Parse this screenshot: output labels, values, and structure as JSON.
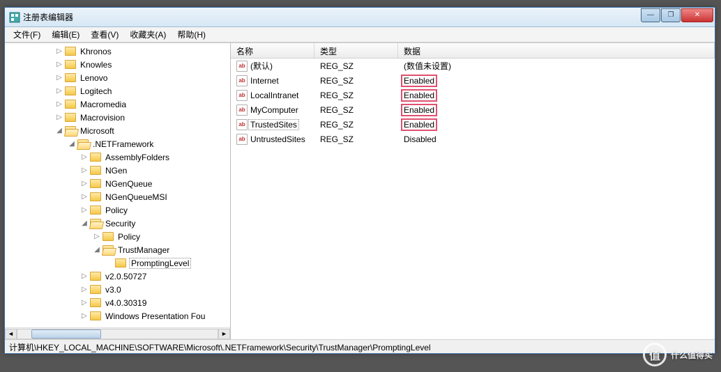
{
  "window": {
    "title": "注册表编辑器"
  },
  "menus": {
    "file": "文件(F)",
    "edit": "编辑(E)",
    "view": "查看(V)",
    "favorites": "收藏夹(A)",
    "help": "帮助(H)"
  },
  "tree": [
    {
      "indent": 4,
      "exp": "▷",
      "open": false,
      "label": "Khronos"
    },
    {
      "indent": 4,
      "exp": "▷",
      "open": false,
      "label": "Knowles"
    },
    {
      "indent": 4,
      "exp": "▷",
      "open": false,
      "label": "Lenovo"
    },
    {
      "indent": 4,
      "exp": "▷",
      "open": false,
      "label": "Logitech"
    },
    {
      "indent": 4,
      "exp": "▷",
      "open": false,
      "label": "Macromedia"
    },
    {
      "indent": 4,
      "exp": "▷",
      "open": false,
      "label": "Macrovision"
    },
    {
      "indent": 4,
      "exp": "◢",
      "open": true,
      "label": "Microsoft"
    },
    {
      "indent": 5,
      "exp": "◢",
      "open": true,
      "label": ".NETFramework"
    },
    {
      "indent": 6,
      "exp": "▷",
      "open": false,
      "label": "AssemblyFolders"
    },
    {
      "indent": 6,
      "exp": "▷",
      "open": false,
      "label": "NGen"
    },
    {
      "indent": 6,
      "exp": "▷",
      "open": false,
      "label": "NGenQueue"
    },
    {
      "indent": 6,
      "exp": "▷",
      "open": false,
      "label": "NGenQueueMSI"
    },
    {
      "indent": 6,
      "exp": "▷",
      "open": false,
      "label": "Policy"
    },
    {
      "indent": 6,
      "exp": "◢",
      "open": true,
      "label": "Security"
    },
    {
      "indent": 7,
      "exp": "▷",
      "open": false,
      "label": "Policy"
    },
    {
      "indent": 7,
      "exp": "◢",
      "open": true,
      "label": "TrustManager"
    },
    {
      "indent": 8,
      "exp": "",
      "open": false,
      "label": "PromptingLevel",
      "selected": true
    },
    {
      "indent": 6,
      "exp": "▷",
      "open": false,
      "label": "v2.0.50727"
    },
    {
      "indent": 6,
      "exp": "▷",
      "open": false,
      "label": "v3.0"
    },
    {
      "indent": 6,
      "exp": "▷",
      "open": false,
      "label": "v4.0.30319"
    },
    {
      "indent": 6,
      "exp": "▷",
      "open": false,
      "label": "Windows Presentation Fou"
    }
  ],
  "columns": {
    "name": "名称",
    "type": "类型",
    "data": "数据"
  },
  "values": [
    {
      "name": "(默认)",
      "type": "REG_SZ",
      "data": "(数值未设置)",
      "hl": false,
      "sel": false
    },
    {
      "name": "Internet",
      "type": "REG_SZ",
      "data": "Enabled",
      "hl": true,
      "sel": false
    },
    {
      "name": "LocalIntranet",
      "type": "REG_SZ",
      "data": "Enabled",
      "hl": true,
      "sel": false
    },
    {
      "name": "MyComputer",
      "type": "REG_SZ",
      "data": "Enabled",
      "hl": true,
      "sel": false
    },
    {
      "name": "TrustedSites",
      "type": "REG_SZ",
      "data": "Enabled",
      "hl": true,
      "sel": true
    },
    {
      "name": "UntrustedSites",
      "type": "REG_SZ",
      "data": "Disabled",
      "hl": false,
      "sel": false
    }
  ],
  "statusbar": "计算机\\HKEY_LOCAL_MACHINE\\SOFTWARE\\Microsoft\\.NETFramework\\Security\\TrustManager\\PromptingLevel",
  "watermark": {
    "icon": "值",
    "text": "什么值得买"
  }
}
